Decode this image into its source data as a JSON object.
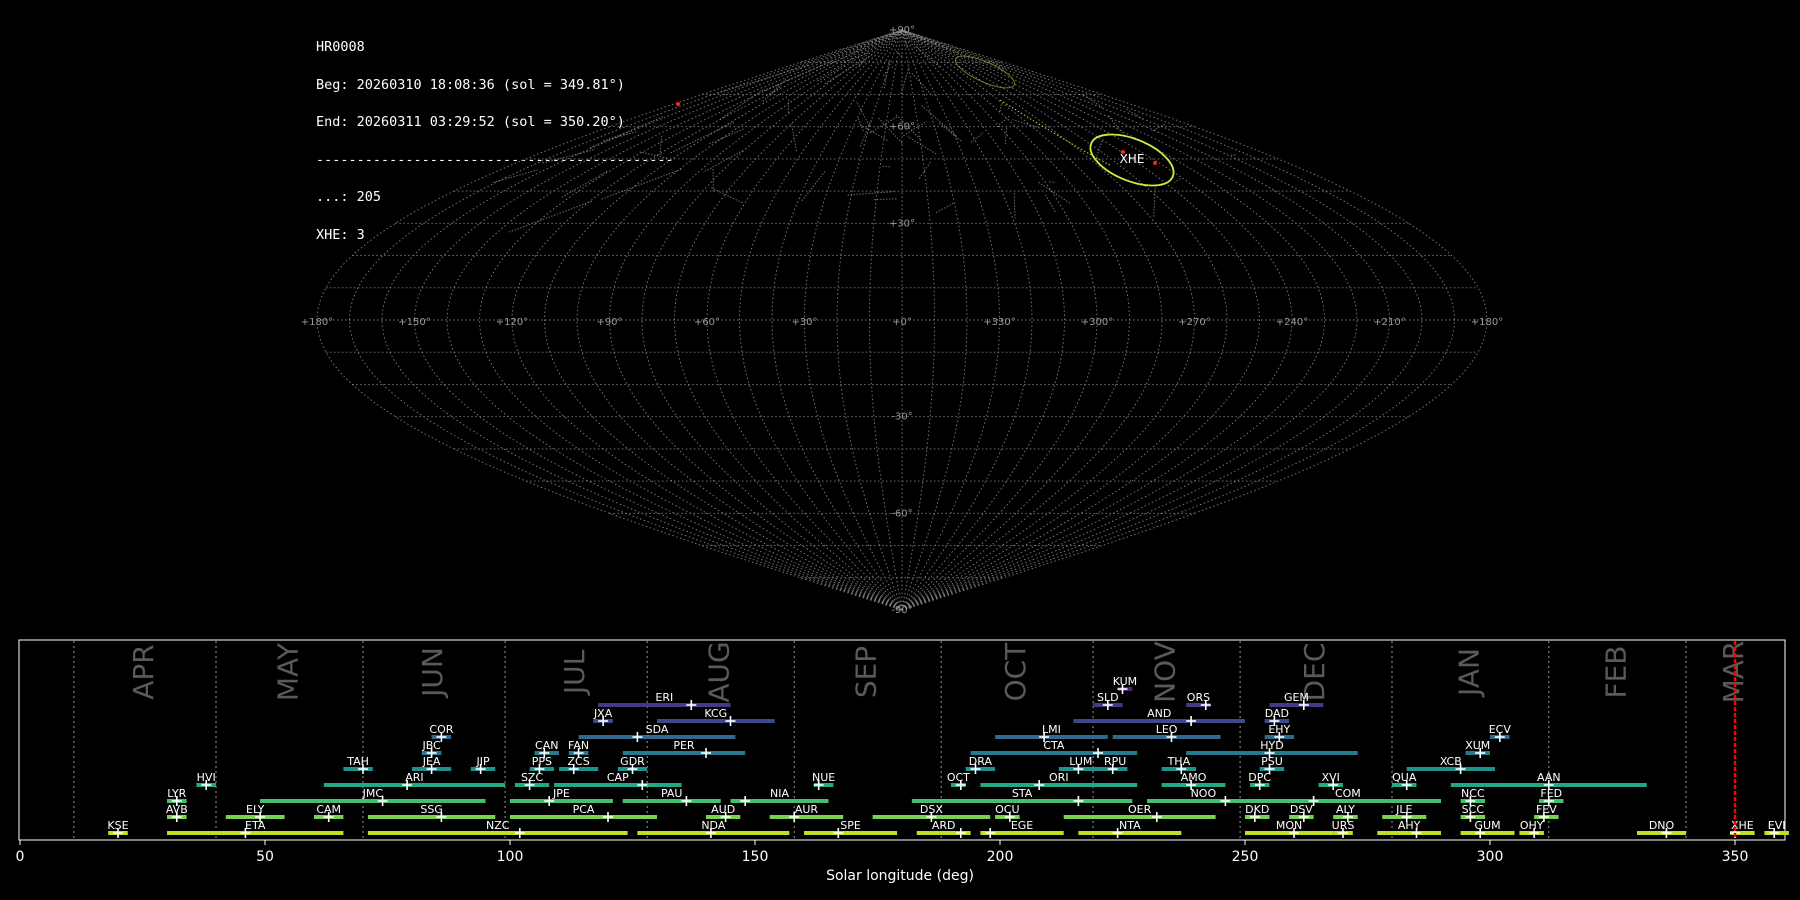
{
  "info": {
    "lines": [
      "HR0008",
      "Beg: 20260310 18:08:36 (sol = 349.81°)",
      "End: 20260311 03:29:52 (sol = 350.20°)",
      "--------------------------------------------",
      "...: 205",
      "XHE: 3"
    ]
  },
  "colors": {
    "background": "#000000",
    "grid": "#808080",
    "highlight_ellipse": "#d4e83a",
    "marker": "#ff2020",
    "current_line": "#ff0000",
    "month_label": "#5a5a5a"
  },
  "sky_map": {
    "projection": "sinusoidal",
    "lat_labels": [
      "+90°",
      "+60°",
      "+30°",
      "-30°",
      "-60°",
      "-90°"
    ],
    "lon_labels": [
      "+180°",
      "+150°",
      "+120°",
      "+90°",
      "+60°",
      "+30°",
      "+0°",
      "+330°",
      "+300°",
      "+270°",
      "+240°",
      "+210°",
      "+180°"
    ],
    "highlight_label": "XHE"
  },
  "chart_data": {
    "type": "timeline",
    "xlabel": "Solar longitude (deg)",
    "xlim": [
      0,
      360
    ],
    "x_ticks": [
      0,
      50,
      100,
      150,
      200,
      250,
      300,
      350
    ],
    "months": [
      {
        "name": "APR",
        "start": 11,
        "end": 40
      },
      {
        "name": "MAY",
        "start": 40,
        "end": 70
      },
      {
        "name": "JUN",
        "start": 70,
        "end": 99
      },
      {
        "name": "JUL",
        "start": 99,
        "end": 128
      },
      {
        "name": "AUG",
        "start": 128,
        "end": 158
      },
      {
        "name": "SEP",
        "start": 158,
        "end": 188
      },
      {
        "name": "OCT",
        "start": 188,
        "end": 219
      },
      {
        "name": "NOV",
        "start": 219,
        "end": 249
      },
      {
        "name": "DEC",
        "start": 249,
        "end": 280
      },
      {
        "name": "JAN",
        "start": 280,
        "end": 312
      },
      {
        "name": "FEB",
        "start": 312,
        "end": 340
      },
      {
        "name": "MAR",
        "start": 340,
        "end": 371
      }
    ],
    "current_sol": 350,
    "showers": [
      {
        "code": "KUM",
        "level": 9,
        "start": 224,
        "end": 227,
        "peak": 225,
        "color": "#482878"
      },
      {
        "code": "SLD",
        "level": 8,
        "start": 219,
        "end": 225,
        "peak": 222,
        "color": "#443983"
      },
      {
        "code": "ORS",
        "level": 8,
        "start": 238,
        "end": 243,
        "peak": 242,
        "color": "#443983"
      },
      {
        "code": "GEM",
        "level": 8,
        "start": 255,
        "end": 266,
        "peak": 262,
        "color": "#443983"
      },
      {
        "code": "ERI",
        "level": 8,
        "start": 118,
        "end": 145,
        "peak": 137,
        "color": "#443983"
      },
      {
        "code": "JXA",
        "level": 7,
        "start": 117,
        "end": 121,
        "peak": 119,
        "color": "#3e4989"
      },
      {
        "code": "KCG",
        "level": 7,
        "start": 130,
        "end": 154,
        "peak": 145,
        "color": "#3e4989"
      },
      {
        "code": "AND",
        "level": 7,
        "start": 215,
        "end": 250,
        "peak": 239,
        "color": "#3e4989"
      },
      {
        "code": "DAD",
        "level": 7,
        "start": 254,
        "end": 259,
        "peak": 256,
        "color": "#3e4989"
      },
      {
        "code": "COR",
        "level": 6,
        "start": 84,
        "end": 88,
        "peak": 86,
        "color": "#31688e"
      },
      {
        "code": "SDA",
        "level": 6,
        "start": 114,
        "end": 146,
        "peak": 126,
        "color": "#31688e"
      },
      {
        "code": "LMI",
        "level": 6,
        "start": 199,
        "end": 222,
        "peak": 209,
        "color": "#31688e"
      },
      {
        "code": "LEO",
        "level": 6,
        "start": 223,
        "end": 245,
        "peak": 235,
        "color": "#31688e"
      },
      {
        "code": "EHY",
        "level": 6,
        "start": 254,
        "end": 260,
        "peak": 257,
        "color": "#31688e"
      },
      {
        "code": "ECV",
        "level": 6,
        "start": 300,
        "end": 304,
        "peak": 302,
        "color": "#31688e"
      },
      {
        "code": "JBC",
        "level": 5,
        "start": 82,
        "end": 86,
        "peak": 84,
        "color": "#2a788e"
      },
      {
        "code": "CAN",
        "level": 5,
        "start": 105,
        "end": 110,
        "peak": 107,
        "color": "#2a788e"
      },
      {
        "code": "FAN",
        "level": 5,
        "start": 112,
        "end": 116,
        "peak": 114,
        "color": "#2a788e"
      },
      {
        "code": "PER",
        "level": 5,
        "start": 123,
        "end": 148,
        "peak": 140,
        "color": "#2a788e"
      },
      {
        "code": "CTA",
        "level": 5,
        "start": 194,
        "end": 228,
        "peak": 220,
        "color": "#2a788e"
      },
      {
        "code": "HYD",
        "level": 5,
        "start": 238,
        "end": 273,
        "peak": 255,
        "color": "#2a788e"
      },
      {
        "code": "XUM",
        "level": 5,
        "start": 295,
        "end": 300,
        "peak": 298,
        "color": "#2a788e"
      },
      {
        "code": "TAH",
        "level": 4,
        "start": 66,
        "end": 72,
        "peak": 70,
        "color": "#21918c"
      },
      {
        "code": "JEA",
        "level": 4,
        "start": 80,
        "end": 88,
        "peak": 84,
        "color": "#21918c"
      },
      {
        "code": "JIP",
        "level": 4,
        "start": 92,
        "end": 97,
        "peak": 94,
        "color": "#21918c"
      },
      {
        "code": "PPS",
        "level": 4,
        "start": 104,
        "end": 109,
        "peak": 106,
        "color": "#21918c"
      },
      {
        "code": "ZCS",
        "level": 4,
        "start": 110,
        "end": 118,
        "peak": 113,
        "color": "#21918c"
      },
      {
        "code": "GDR",
        "level": 4,
        "start": 122,
        "end": 128,
        "peak": 125,
        "color": "#21918c"
      },
      {
        "code": "DRA",
        "level": 4,
        "start": 193,
        "end": 199,
        "peak": 195,
        "color": "#21918c"
      },
      {
        "code": "LUM",
        "level": 4,
        "start": 212,
        "end": 221,
        "peak": 216,
        "color": "#21918c"
      },
      {
        "code": "RPU",
        "level": 4,
        "start": 221,
        "end": 226,
        "peak": 223,
        "color": "#21918c"
      },
      {
        "code": "THA",
        "level": 4,
        "start": 233,
        "end": 240,
        "peak": 237,
        "color": "#21918c"
      },
      {
        "code": "PSU",
        "level": 4,
        "start": 253,
        "end": 258,
        "peak": 255,
        "color": "#21918c"
      },
      {
        "code": "XCB",
        "level": 4,
        "start": 283,
        "end": 301,
        "peak": 294,
        "color": "#21918c"
      },
      {
        "code": "HVI",
        "level": 3,
        "start": 36,
        "end": 40,
        "peak": 38,
        "color": "#22a884"
      },
      {
        "code": "ARI",
        "level": 3,
        "start": 62,
        "end": 99,
        "peak": 79,
        "color": "#22a884"
      },
      {
        "code": "SZC",
        "level": 3,
        "start": 101,
        "end": 108,
        "peak": 104,
        "color": "#22a884"
      },
      {
        "code": "CAP",
        "level": 3,
        "start": 109,
        "end": 135,
        "peak": 127,
        "color": "#22a884"
      },
      {
        "code": "NUE",
        "level": 3,
        "start": 162,
        "end": 166,
        "peak": 163,
        "color": "#22a884"
      },
      {
        "code": "OCT",
        "level": 3,
        "start": 190,
        "end": 193,
        "peak": 192,
        "color": "#22a884"
      },
      {
        "code": "ORI",
        "level": 3,
        "start": 196,
        "end": 228,
        "peak": 208,
        "color": "#22a884"
      },
      {
        "code": "AMO",
        "level": 3,
        "start": 233,
        "end": 246,
        "peak": 239,
        "color": "#22a884"
      },
      {
        "code": "DPC",
        "level": 3,
        "start": 251,
        "end": 255,
        "peak": 253,
        "color": "#22a884"
      },
      {
        "code": "XVI",
        "level": 3,
        "start": 265,
        "end": 270,
        "peak": 268,
        "color": "#22a884"
      },
      {
        "code": "QUA",
        "level": 3,
        "start": 280,
        "end": 285,
        "peak": 283,
        "color": "#22a884"
      },
      {
        "code": "AAN",
        "level": 3,
        "start": 292,
        "end": 332,
        "peak": 312,
        "color": "#22a884"
      },
      {
        "code": "LYR",
        "level": 2,
        "start": 30,
        "end": 34,
        "peak": 32,
        "color": "#44bf70"
      },
      {
        "code": "JMC",
        "level": 2,
        "start": 49,
        "end": 95,
        "peak": 74,
        "color": "#44bf70"
      },
      {
        "code": "JPE",
        "level": 2,
        "start": 100,
        "end": 121,
        "peak": 108,
        "color": "#44bf70"
      },
      {
        "code": "PAU",
        "level": 2,
        "start": 123,
        "end": 143,
        "peak": 136,
        "color": "#44bf70"
      },
      {
        "code": "NIA",
        "level": 2,
        "start": 145,
        "end": 165,
        "peak": 148,
        "color": "#44bf70"
      },
      {
        "code": "STA",
        "level": 2,
        "start": 182,
        "end": 227,
        "peak": 216,
        "color": "#44bf70"
      },
      {
        "code": "NOO",
        "level": 2,
        "start": 230,
        "end": 253,
        "peak": 246,
        "color": "#44bf70"
      },
      {
        "code": "COM",
        "level": 2,
        "start": 252,
        "end": 290,
        "peak": 264,
        "color": "#44bf70"
      },
      {
        "code": "NCC",
        "level": 2,
        "start": 294,
        "end": 299,
        "peak": 296,
        "color": "#44bf70"
      },
      {
        "code": "FED",
        "level": 2,
        "start": 310,
        "end": 315,
        "peak": 312,
        "color": "#44bf70"
      },
      {
        "code": "AVB",
        "level": 1,
        "start": 30,
        "end": 34,
        "peak": 32,
        "color": "#7ad151"
      },
      {
        "code": "ELY",
        "level": 1,
        "start": 42,
        "end": 54,
        "peak": 49,
        "color": "#7ad151"
      },
      {
        "code": "CAM",
        "level": 1,
        "start": 60,
        "end": 66,
        "peak": 63,
        "color": "#7ad151"
      },
      {
        "code": "SSG",
        "level": 1,
        "start": 71,
        "end": 97,
        "peak": 86,
        "color": "#7ad151"
      },
      {
        "code": "PCA",
        "level": 1,
        "start": 100,
        "end": 130,
        "peak": 120,
        "color": "#7ad151"
      },
      {
        "code": "AUD",
        "level": 1,
        "start": 140,
        "end": 147,
        "peak": 144,
        "color": "#7ad151"
      },
      {
        "code": "AUR",
        "level": 1,
        "start": 153,
        "end": 168,
        "peak": 158,
        "color": "#7ad151"
      },
      {
        "code": "DSX",
        "level": 1,
        "start": 174,
        "end": 198,
        "peak": 186,
        "color": "#7ad151"
      },
      {
        "code": "OCU",
        "level": 1,
        "start": 199,
        "end": 204,
        "peak": 202,
        "color": "#7ad151"
      },
      {
        "code": "OER",
        "level": 1,
        "start": 213,
        "end": 244,
        "peak": 232,
        "color": "#7ad151"
      },
      {
        "code": "DKD",
        "level": 1,
        "start": 250,
        "end": 255,
        "peak": 252,
        "color": "#7ad151"
      },
      {
        "code": "DSV",
        "level": 1,
        "start": 259,
        "end": 264,
        "peak": 262,
        "color": "#7ad151"
      },
      {
        "code": "ALY",
        "level": 1,
        "start": 268,
        "end": 273,
        "peak": 271,
        "color": "#7ad151"
      },
      {
        "code": "JLE",
        "level": 1,
        "start": 278,
        "end": 287,
        "peak": 283,
        "color": "#7ad151"
      },
      {
        "code": "SCC",
        "level": 1,
        "start": 294,
        "end": 299,
        "peak": 296,
        "color": "#7ad151"
      },
      {
        "code": "FEV",
        "level": 1,
        "start": 309,
        "end": 314,
        "peak": 311,
        "color": "#7ad151"
      },
      {
        "code": "KSE",
        "level": 0,
        "start": 18,
        "end": 22,
        "peak": 20,
        "color": "#bddf26"
      },
      {
        "code": "ETA",
        "level": 0,
        "start": 30,
        "end": 66,
        "peak": 46,
        "color": "#bddf26"
      },
      {
        "code": "NZC",
        "level": 0,
        "start": 71,
        "end": 124,
        "peak": 102,
        "color": "#bddf26"
      },
      {
        "code": "NDA",
        "level": 0,
        "start": 126,
        "end": 157,
        "peak": 141,
        "color": "#bddf26"
      },
      {
        "code": "SPE",
        "level": 0,
        "start": 160,
        "end": 179,
        "peak": 167,
        "color": "#bddf26"
      },
      {
        "code": "ARD",
        "level": 0,
        "start": 183,
        "end": 194,
        "peak": 192,
        "color": "#bddf26"
      },
      {
        "code": "EGE",
        "level": 0,
        "start": 196,
        "end": 213,
        "peak": 198,
        "color": "#bddf26"
      },
      {
        "code": "NTA",
        "level": 0,
        "start": 216,
        "end": 237,
        "peak": 224,
        "color": "#bddf26"
      },
      {
        "code": "MON",
        "level": 0,
        "start": 250,
        "end": 268,
        "peak": 260,
        "color": "#bddf26"
      },
      {
        "code": "URS",
        "level": 0,
        "start": 268,
        "end": 272,
        "peak": 270,
        "color": "#bddf26"
      },
      {
        "code": "AHY",
        "level": 0,
        "start": 277,
        "end": 290,
        "peak": 285,
        "color": "#bddf26"
      },
      {
        "code": "GUM",
        "level": 0,
        "start": 294,
        "end": 305,
        "peak": 298,
        "color": "#bddf26"
      },
      {
        "code": "OHY",
        "level": 0,
        "start": 306,
        "end": 311,
        "peak": 309,
        "color": "#bddf26"
      },
      {
        "code": "DNO",
        "level": 0,
        "start": 330,
        "end": 340,
        "peak": 336,
        "color": "#bddf26"
      },
      {
        "code": "XHE",
        "level": 0,
        "start": 349,
        "end": 354,
        "peak": 350,
        "color": "#bddf26"
      },
      {
        "code": "EVI",
        "level": 0,
        "start": 356,
        "end": 361,
        "peak": 358,
        "color": "#bddf26"
      }
    ]
  }
}
